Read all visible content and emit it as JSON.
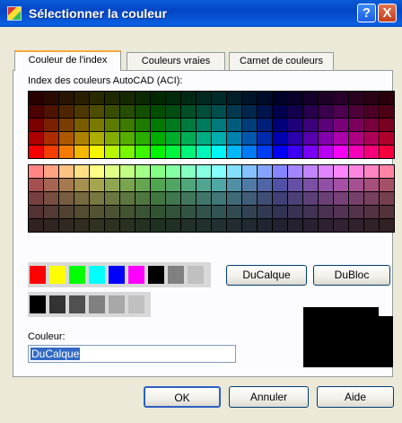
{
  "window": {
    "title": "Sélectionner la couleur",
    "help_label": "?",
    "close_label": "X"
  },
  "tabs": [
    {
      "label": "Couleur de l'index",
      "active": true
    },
    {
      "label": "Couleurs vraies",
      "active": false
    },
    {
      "label": "Carnet de couleurs",
      "active": false
    }
  ],
  "aci": {
    "label": "Index des couleurs AutoCAD (ACI):"
  },
  "standard_colors": [
    "#ff0000",
    "#ffff00",
    "#00ff00",
    "#00ffff",
    "#0000ff",
    "#ff00ff",
    "#000000",
    "#808080",
    "#c0c0c0"
  ],
  "gray_colors": [
    "#000000",
    "#333333",
    "#505050",
    "#808080",
    "#a8a8a8",
    "#c0c0c0"
  ],
  "buttons": {
    "bylayer": "DuCalque",
    "byblock": "DuBloc",
    "ok": "OK",
    "cancel": "Annuler",
    "help": "Aide"
  },
  "color_field": {
    "label": "Couleur:",
    "value": "DuCalque"
  },
  "preview": {
    "current": "#000000",
    "previous": "#000000"
  }
}
